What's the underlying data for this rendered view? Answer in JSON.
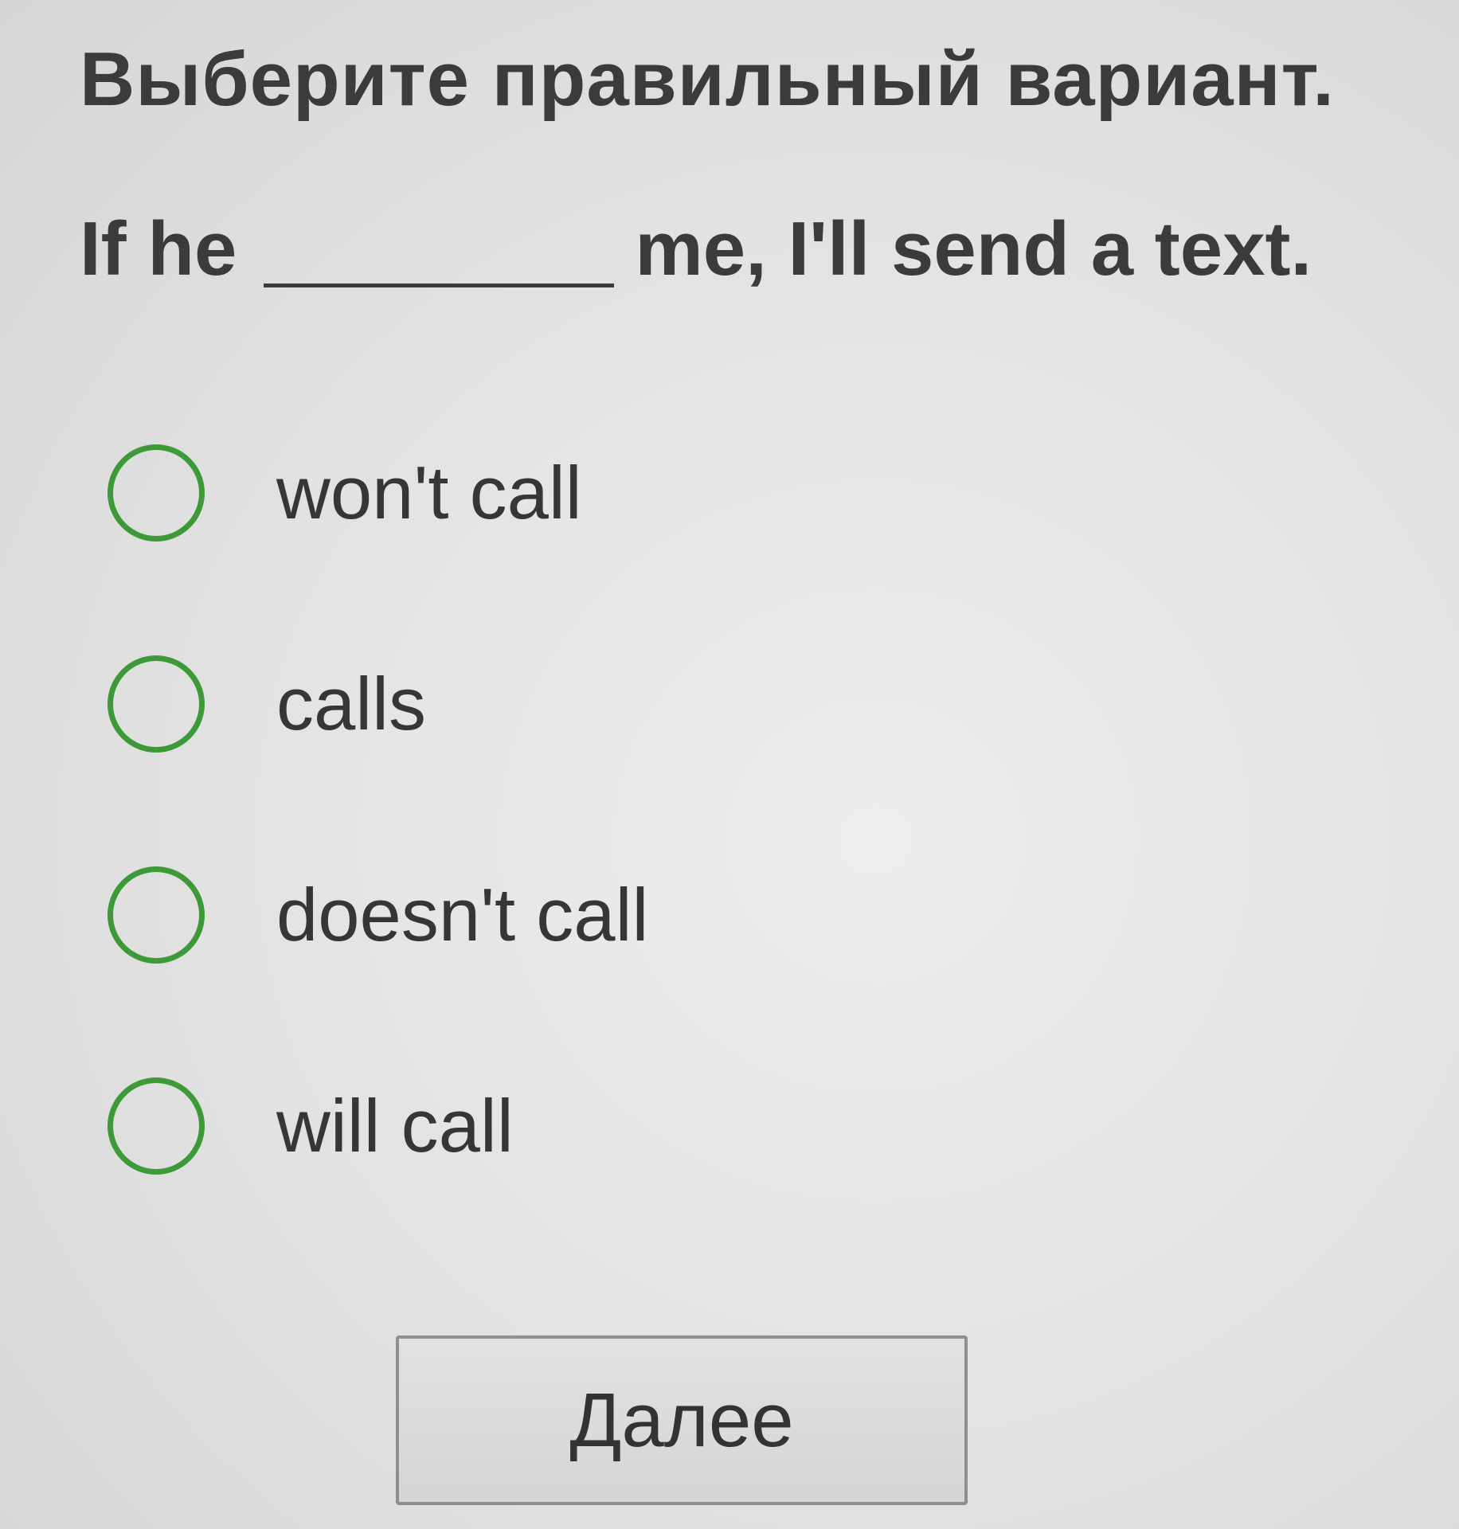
{
  "question": {
    "instruction": "Выберите правильный вариант.",
    "sentence_before": "If he",
    "sentence_after": "me, I'll send a text."
  },
  "options": [
    {
      "label": "won't call",
      "selected": false
    },
    {
      "label": "calls",
      "selected": false
    },
    {
      "label": "doesn't call",
      "selected": false
    },
    {
      "label": "will call",
      "selected": false
    }
  ],
  "next_button": {
    "label": "Далее"
  },
  "colors": {
    "radio_border": "#3e9a38",
    "background": "#e4e4e4",
    "text": "#3b3b3b"
  }
}
